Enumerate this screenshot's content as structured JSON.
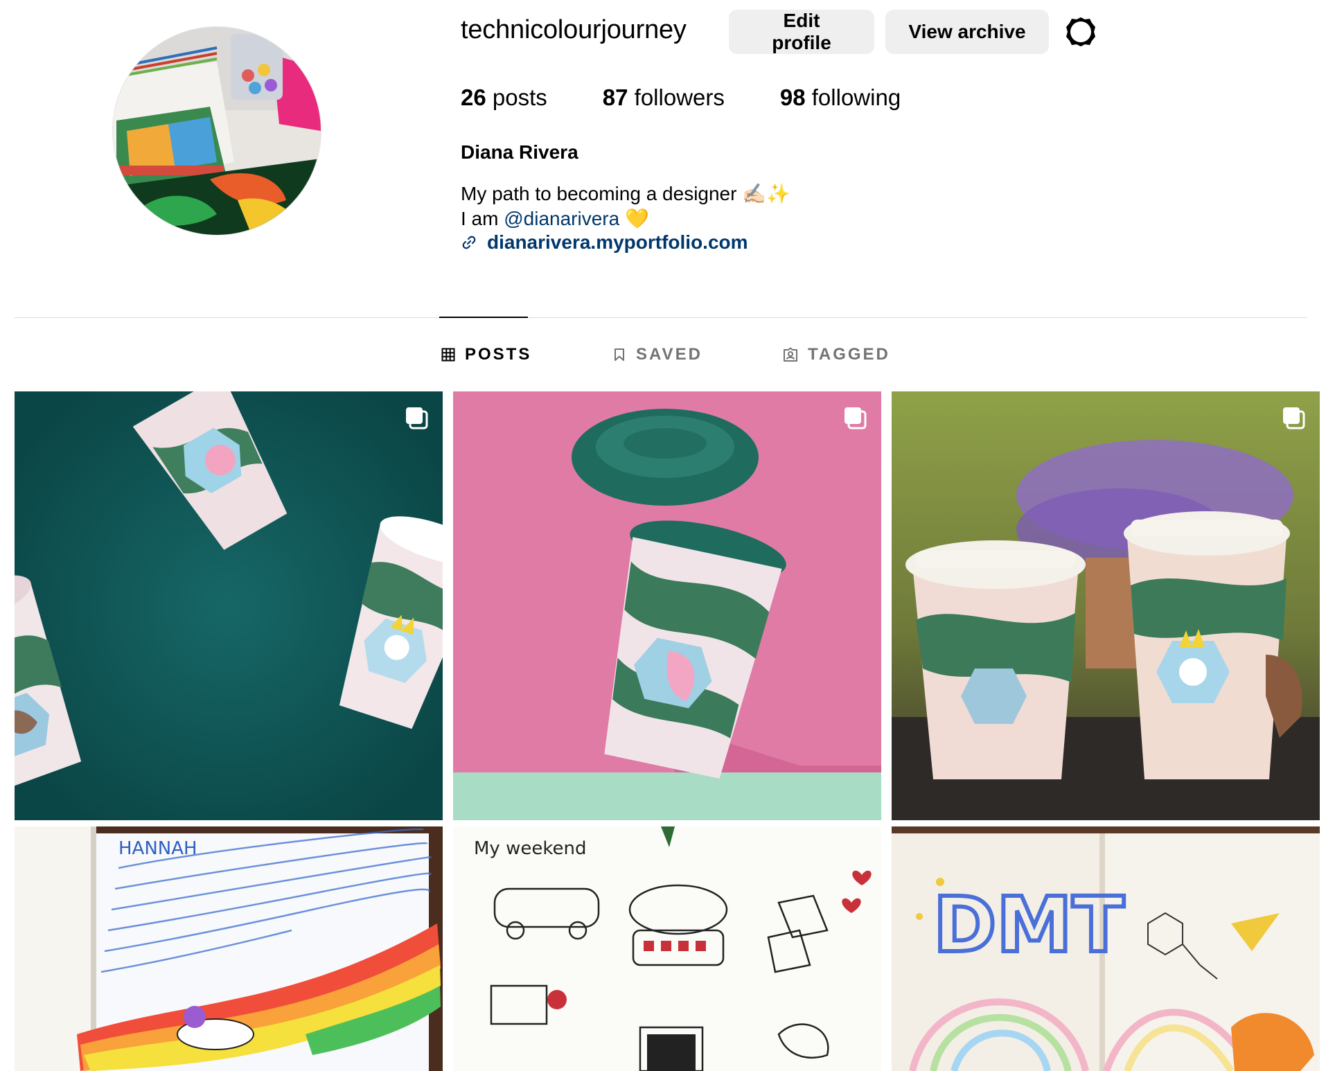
{
  "profile": {
    "username": "technicolourjourney",
    "edit_label": "Edit profile",
    "archive_label": "View archive",
    "settings_icon": "gear-icon",
    "stats": {
      "posts_count": "26",
      "posts_label": "posts",
      "followers_count": "87",
      "followers_label": "followers",
      "following_count": "98",
      "following_label": "following"
    },
    "full_name": "Diana Rivera",
    "bio_line1": "My path to becoming a designer ✍🏻✨",
    "bio_line2_prefix": "I am ",
    "bio_mention": "@dianarivera",
    "bio_line2_suffix": " 💛",
    "link_text": "dianarivera.myportfolio.com"
  },
  "tabs": [
    {
      "label": "POSTS",
      "icon": "grid-icon",
      "active": true
    },
    {
      "label": "SAVED",
      "icon": "bookmark-icon",
      "active": false
    },
    {
      "label": "TAGGED",
      "icon": "tagged-icon",
      "active": false
    }
  ],
  "posts": [
    {
      "description": "Three floating paper cups with bird illustrations on teal background",
      "multi": true,
      "bg": "#0f5656"
    },
    {
      "description": "Floating paper cup with green lid on pink background",
      "multi": true,
      "bg": "#e07ba6"
    },
    {
      "description": "Two cups held outdoors with lavender behind",
      "multi": true,
      "bg": "#9aa35a"
    },
    {
      "description": "Handwritten journal page with rainbow and dog",
      "multi": false,
      "bg": "#f6f7fb",
      "text": "HANNAH"
    },
    {
      "description": "Sketchbook page My weekend",
      "multi": false,
      "bg": "#fbfbf8",
      "text": "My weekend"
    },
    {
      "description": "Journal page DMT rainbow",
      "multi": false,
      "bg": "#f3efe6",
      "text": "DMT"
    }
  ],
  "colors": {
    "link": "#00376b",
    "button_bg": "#efefef",
    "divider": "#dbdbdb",
    "inactive_tab": "#737373"
  }
}
